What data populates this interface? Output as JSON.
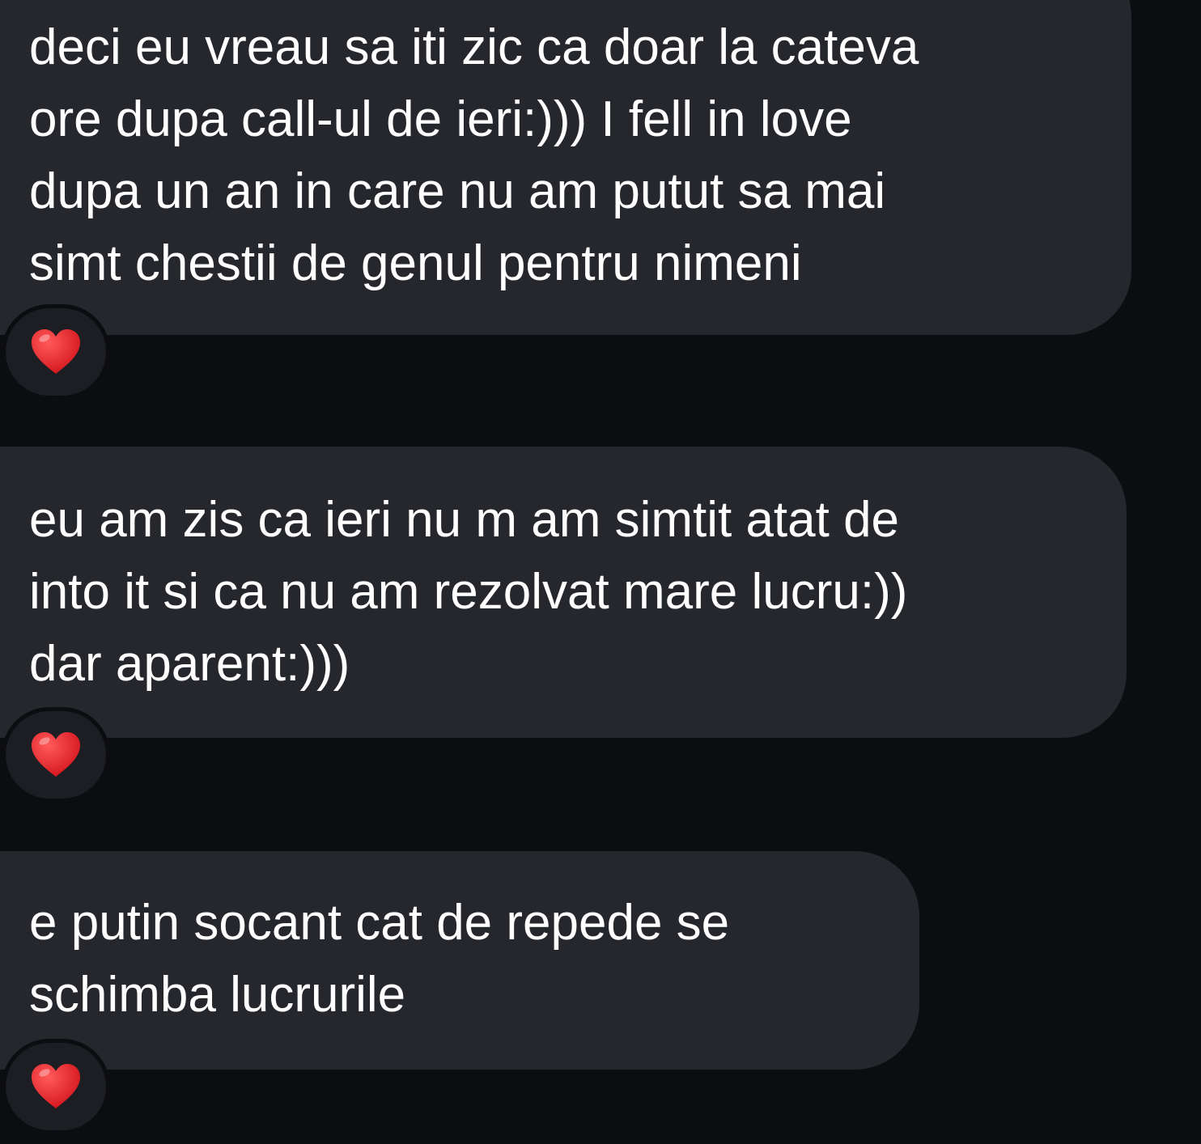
{
  "messages": [
    {
      "text": "deci eu vreau sa iti zic ca doar la cateva\nore dupa call-ul de ieri:))) I fell in love\ndupa un an in care nu am putut sa mai\nsimt chestii de genul pentru nimeni",
      "reaction": "heart-icon"
    },
    {
      "text": "eu am zis ca ieri nu m am simtit atat de\ninto it si ca nu am rezolvat mare lucru:))\ndar aparent:)))",
      "reaction": "heart-icon"
    },
    {
      "text": "e putin socant cat de repede se\nschimba lucrurile",
      "reaction": "heart-icon"
    }
  ],
  "colors": {
    "background": "#0c0d11",
    "bubble": "#26272c",
    "text": "#ffffff",
    "heart": "#e0202a"
  }
}
